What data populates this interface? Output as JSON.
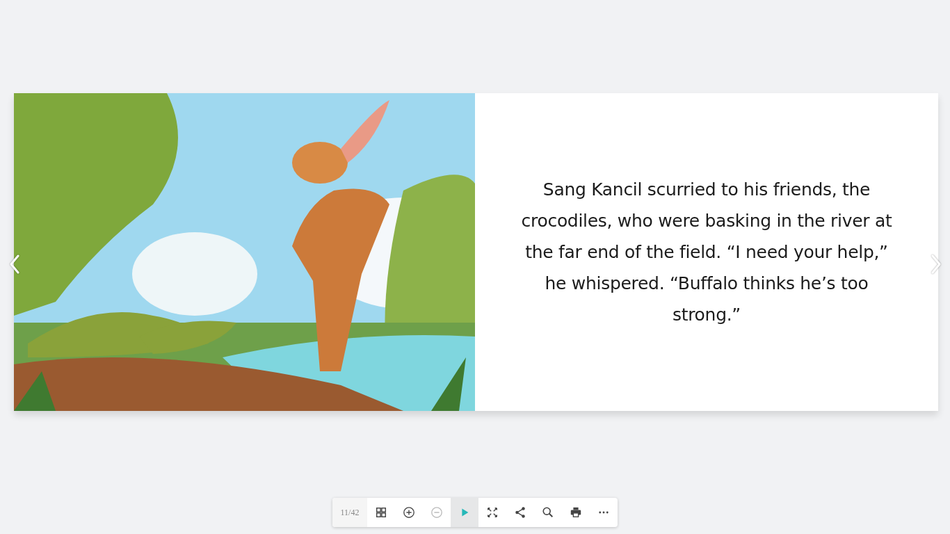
{
  "book": {
    "right_page": {
      "text": "Sang Kancil scurried to his friends, the crocodiles, who were basking in the river at the far end of the field. “I need your help,” he whispered. “Buffalo thinks he’s too strong.”"
    }
  },
  "toolbar": {
    "page_indicator": "11/42",
    "buttons": [
      {
        "kind": "thumbnails",
        "selected": false,
        "disabled": false
      },
      {
        "kind": "zoom-in",
        "selected": false,
        "disabled": false
      },
      {
        "kind": "zoom-out",
        "selected": false,
        "disabled": true
      },
      {
        "kind": "play",
        "selected": true,
        "disabled": false
      },
      {
        "kind": "fullscreen",
        "selected": false,
        "disabled": false
      },
      {
        "kind": "share",
        "selected": false,
        "disabled": false
      },
      {
        "kind": "search",
        "selected": false,
        "disabled": false
      },
      {
        "kind": "print",
        "selected": false,
        "disabled": false
      },
      {
        "kind": "more",
        "selected": false,
        "disabled": false
      }
    ]
  }
}
